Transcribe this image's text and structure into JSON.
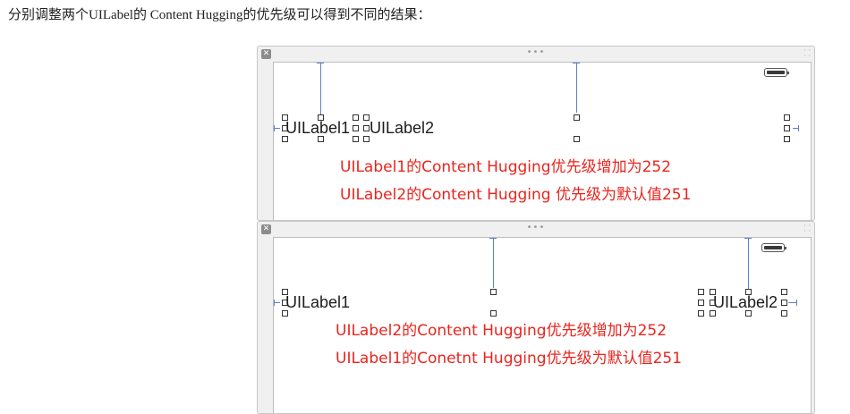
{
  "intro": "分别调整两个UILabel的 Content Hugging的优先级可以得到不同的结果：",
  "panel1": {
    "label_left": "UILabel1",
    "label_right": "UILabel2",
    "note_line1": "UILabel1的Content Hugging优先级增加为252",
    "note_line2": "UILabel2的Content Hugging 优先级为默认值251"
  },
  "panel2": {
    "label_left": "UILabel1",
    "label_right": "UILabel2",
    "note_line1": "UILabel2的Content Hugging优先级增加为252",
    "note_line2": "UILabel1的Conetnt Hugging优先级为默认值251"
  },
  "icons": {
    "close": "close-icon",
    "grip": "drag-grip-icon",
    "resize": "resize-grip-icon",
    "battery": "battery-icon"
  },
  "colors": {
    "note_text": "#e8251e",
    "constraint": "#5b82c4"
  }
}
